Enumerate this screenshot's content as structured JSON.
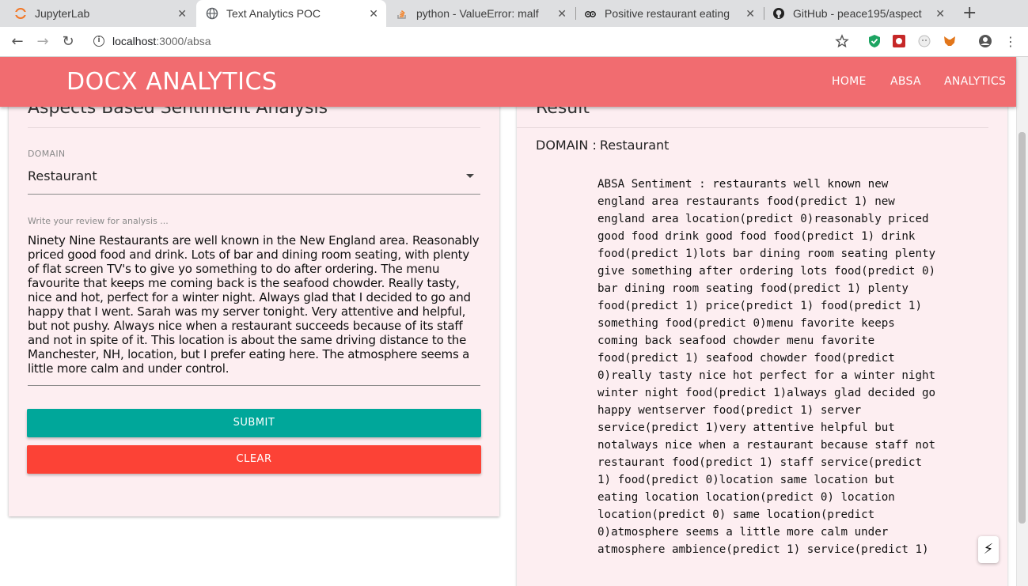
{
  "browser": {
    "tabs": [
      {
        "title": "JupyterLab",
        "active": false
      },
      {
        "title": "Text Analytics POC",
        "active": true
      },
      {
        "title": "python - ValueError: malf",
        "active": false
      },
      {
        "title": "Positive restaurant eating",
        "active": false
      },
      {
        "title": "GitHub - peace195/aspect",
        "active": false
      }
    ],
    "close_glyph": "✕",
    "new_tab_glyph": "+",
    "url_host": "localhost",
    "url_path": ":3000/absa"
  },
  "app": {
    "brand": "DOCX ANALYTICS",
    "nav": [
      "HOME",
      "ABSA",
      "ANALYTICS"
    ],
    "accent": "#f16c70"
  },
  "form": {
    "title": "Aspects Based Sentiment Analysis",
    "domain_label": "DOMAIN",
    "domain_value": "Restaurant",
    "review_label": "Write your review for analysis ...",
    "review_text": "Ninety Nine Restaurants are well known in the New England area. Reasonably priced good food and drink. Lots of bar and dining room seating, with plenty of flat screen TV's to give yo something to do after ordering. The menu favourite that keeps me coming back is the seafood chowder. Really tasty, nice and hot, perfect for a winter night. Always glad that I decided to go and happy that I went. Sarah was my server tonight. Very attentive and helpful, but not pushy. Always nice when a restaurant succeeds because of its staff and not in spite of it. This location is about the same driving distance to the Manchester, NH, location, but I prefer eating here. The atmosphere seems a little more calm and under control.",
    "submit_label": "SUBMIT",
    "clear_label": "CLEAR",
    "submit_color": "#00a79a",
    "clear_color": "#fc4236"
  },
  "result": {
    "title": "Result",
    "domain_prefix": "DOMAIN :",
    "domain_value": "Restaurant",
    "text": "ABSA Sentiment : restaurants well known new england area restaurants food(predict 1) new england area location(predict 0)reasonably priced good food drink good food food(predict 1) drink food(predict 1)lots bar dining room seating plenty give something after ordering lots food(predict 0) bar dining room seating food(predict 1) plenty food(predict 1) price(predict 1) food(predict 1) something food(predict 0)menu favorite keeps coming back seafood chowder menu favorite food(predict 1) seafood chowder food(predict 0)really tasty nice hot perfect for a winter night winter night food(predict 1)always glad decided go happy wentserver food(predict 1) server service(predict 1)very attentive helpful but notalways nice when a restaurant because staff not restaurant food(predict 1) staff service(predict 1) food(predict 0)location same location but eating location location(predict 0) location location(predict 0) same location(predict 0)atmosphere seems a little more calm under atmosphere ambience(predict 1) service(predict 1)"
  }
}
